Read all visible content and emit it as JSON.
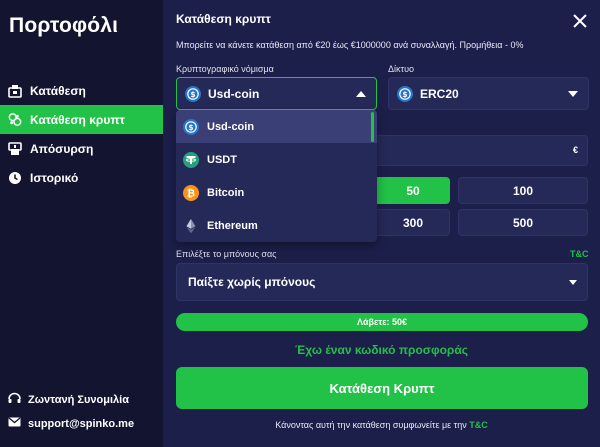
{
  "sidebar": {
    "title": "Πορτοφόλι",
    "items": [
      {
        "label": "Κατάθεση",
        "icon": "deposit-icon",
        "active": false
      },
      {
        "label": "Κατάθεση κρυπτ",
        "icon": "crypto-icon",
        "active": true
      },
      {
        "label": "Απόσυρση",
        "icon": "withdraw-icon",
        "active": false
      },
      {
        "label": "Ιστορικό",
        "icon": "history-icon",
        "active": false
      }
    ],
    "live_chat": "Ζωντανή Συνομιλία",
    "support_email": "support@spinko.me"
  },
  "modal": {
    "title": "Κατάθεση κρυπτ",
    "info": "Μπορείτε να κάνετε κατάθεση από €20 έως €1000000 ανά συναλλαγή. Προμήθεια - 0%",
    "currency_label": "Κρυπτογραφικό νόμισμα",
    "currency_value": "Usd-coin",
    "network_label": "Δίκτυο",
    "network_value": "ERC20",
    "currency_unit": "€",
    "dropdown_options": [
      "Usd-coin",
      "USDT",
      "Bitcoin",
      "Ethereum"
    ],
    "amount_chips": [
      "50",
      "100",
      "300",
      "500"
    ],
    "bonus_label": "Επιλέξτε το μπόνους σας",
    "tc": "T&C",
    "bonus_value": "Παίξτε χωρίς μπόνους",
    "receive": "Λάβετε: 50€",
    "promo": "Έχω έναν κωδικό προσφοράς",
    "deposit_button": "Κατάθεση Κρυπτ",
    "terms_text": "Κάνοντας αυτή την κατάθεση συμφωνείτε με την",
    "terms_link": "T&C"
  },
  "colors": {
    "accent": "#22c147",
    "bg": "#1c1f4a",
    "sidebar_bg": "#131530",
    "field_bg": "#252957"
  }
}
